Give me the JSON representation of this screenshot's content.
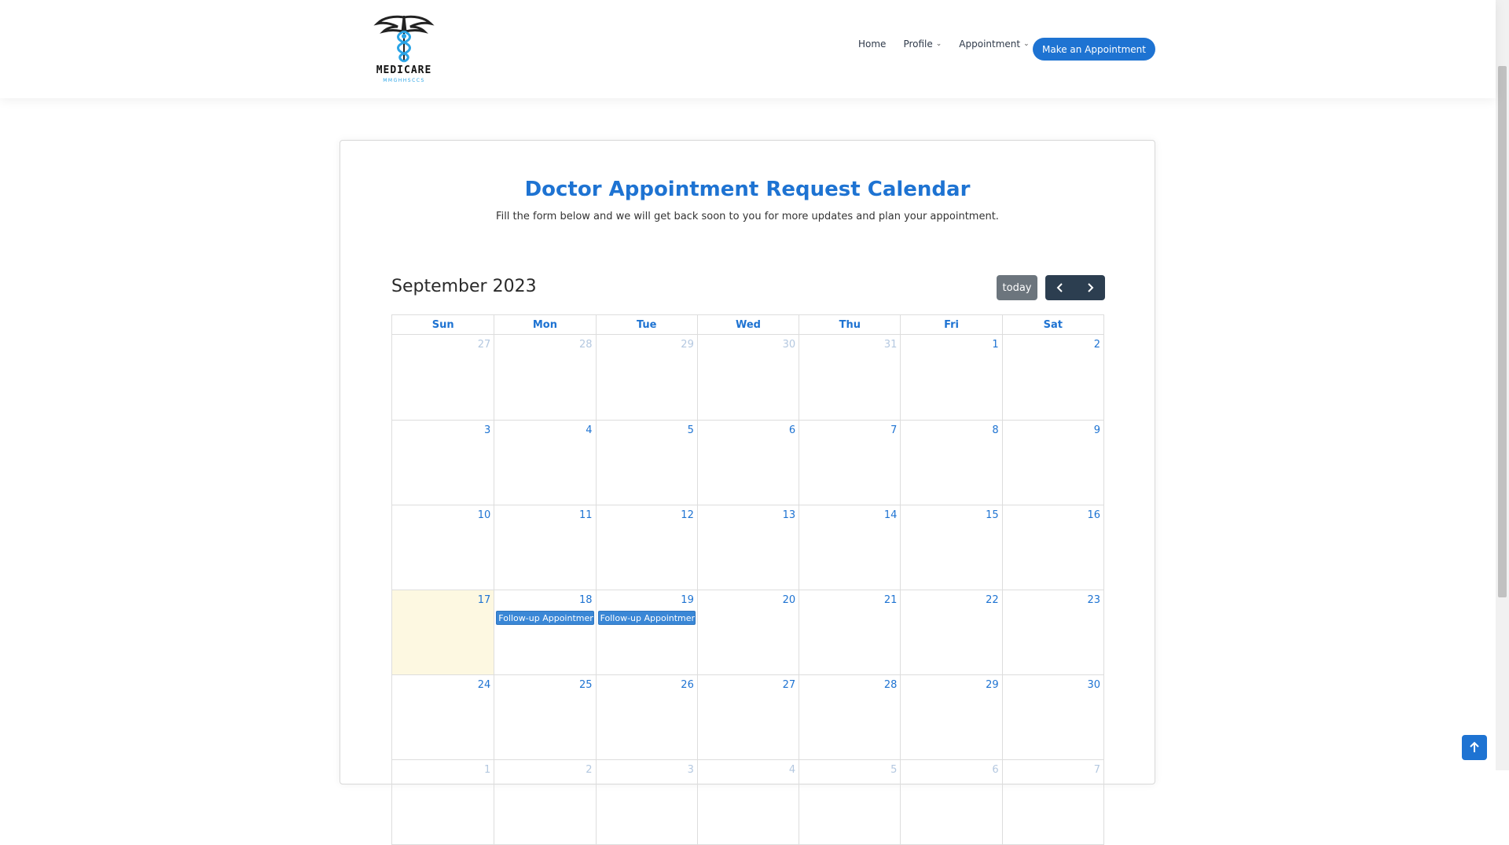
{
  "header": {
    "logo_text": "MEDICARE",
    "logo_sub": "MMGHHSCCS",
    "nav": [
      {
        "label": "Home",
        "dropdown": false
      },
      {
        "label": "Profile",
        "dropdown": true
      },
      {
        "label": "Appointment",
        "dropdown": true
      }
    ],
    "cta_label": "Make an Appointment"
  },
  "page": {
    "title": "Doctor Appointment Request Calendar",
    "subtitle": "Fill the form below and we will get back soon to you for more updates and plan your appointment."
  },
  "calendar": {
    "month_label": "September 2023",
    "today_label": "today",
    "weekdays": [
      "Sun",
      "Mon",
      "Tue",
      "Wed",
      "Thu",
      "Fri",
      "Sat"
    ],
    "weeks": [
      [
        {
          "d": "27",
          "other": true
        },
        {
          "d": "28",
          "other": true
        },
        {
          "d": "29",
          "other": true
        },
        {
          "d": "30",
          "other": true
        },
        {
          "d": "31",
          "other": true
        },
        {
          "d": "1"
        },
        {
          "d": "2"
        }
      ],
      [
        {
          "d": "3"
        },
        {
          "d": "4"
        },
        {
          "d": "5"
        },
        {
          "d": "6"
        },
        {
          "d": "7"
        },
        {
          "d": "8"
        },
        {
          "d": "9"
        }
      ],
      [
        {
          "d": "10"
        },
        {
          "d": "11"
        },
        {
          "d": "12"
        },
        {
          "d": "13"
        },
        {
          "d": "14"
        },
        {
          "d": "15"
        },
        {
          "d": "16"
        }
      ],
      [
        {
          "d": "17",
          "today": true
        },
        {
          "d": "18",
          "event": "Follow-up Appointment"
        },
        {
          "d": "19",
          "event": "Follow-up Appointment"
        },
        {
          "d": "20"
        },
        {
          "d": "21"
        },
        {
          "d": "22"
        },
        {
          "d": "23"
        }
      ],
      [
        {
          "d": "24"
        },
        {
          "d": "25"
        },
        {
          "d": "26"
        },
        {
          "d": "27"
        },
        {
          "d": "28"
        },
        {
          "d": "29"
        },
        {
          "d": "30"
        }
      ],
      [
        {
          "d": "1",
          "other": true
        },
        {
          "d": "2",
          "other": true
        },
        {
          "d": "3",
          "other": true
        },
        {
          "d": "4",
          "other": true
        },
        {
          "d": "5",
          "other": true
        },
        {
          "d": "6",
          "other": true
        },
        {
          "d": "7",
          "other": true
        }
      ]
    ]
  },
  "icons": {
    "prev": "chevron-left-icon",
    "next": "chevron-right-icon",
    "back_to_top": "arrow-up-icon"
  },
  "colors": {
    "brand_blue": "#1e73d2",
    "event_blue": "#3a87d6",
    "today_bg": "#fdf8e1",
    "nav_dark": "#2c3e50",
    "today_btn": "#6c757d"
  }
}
